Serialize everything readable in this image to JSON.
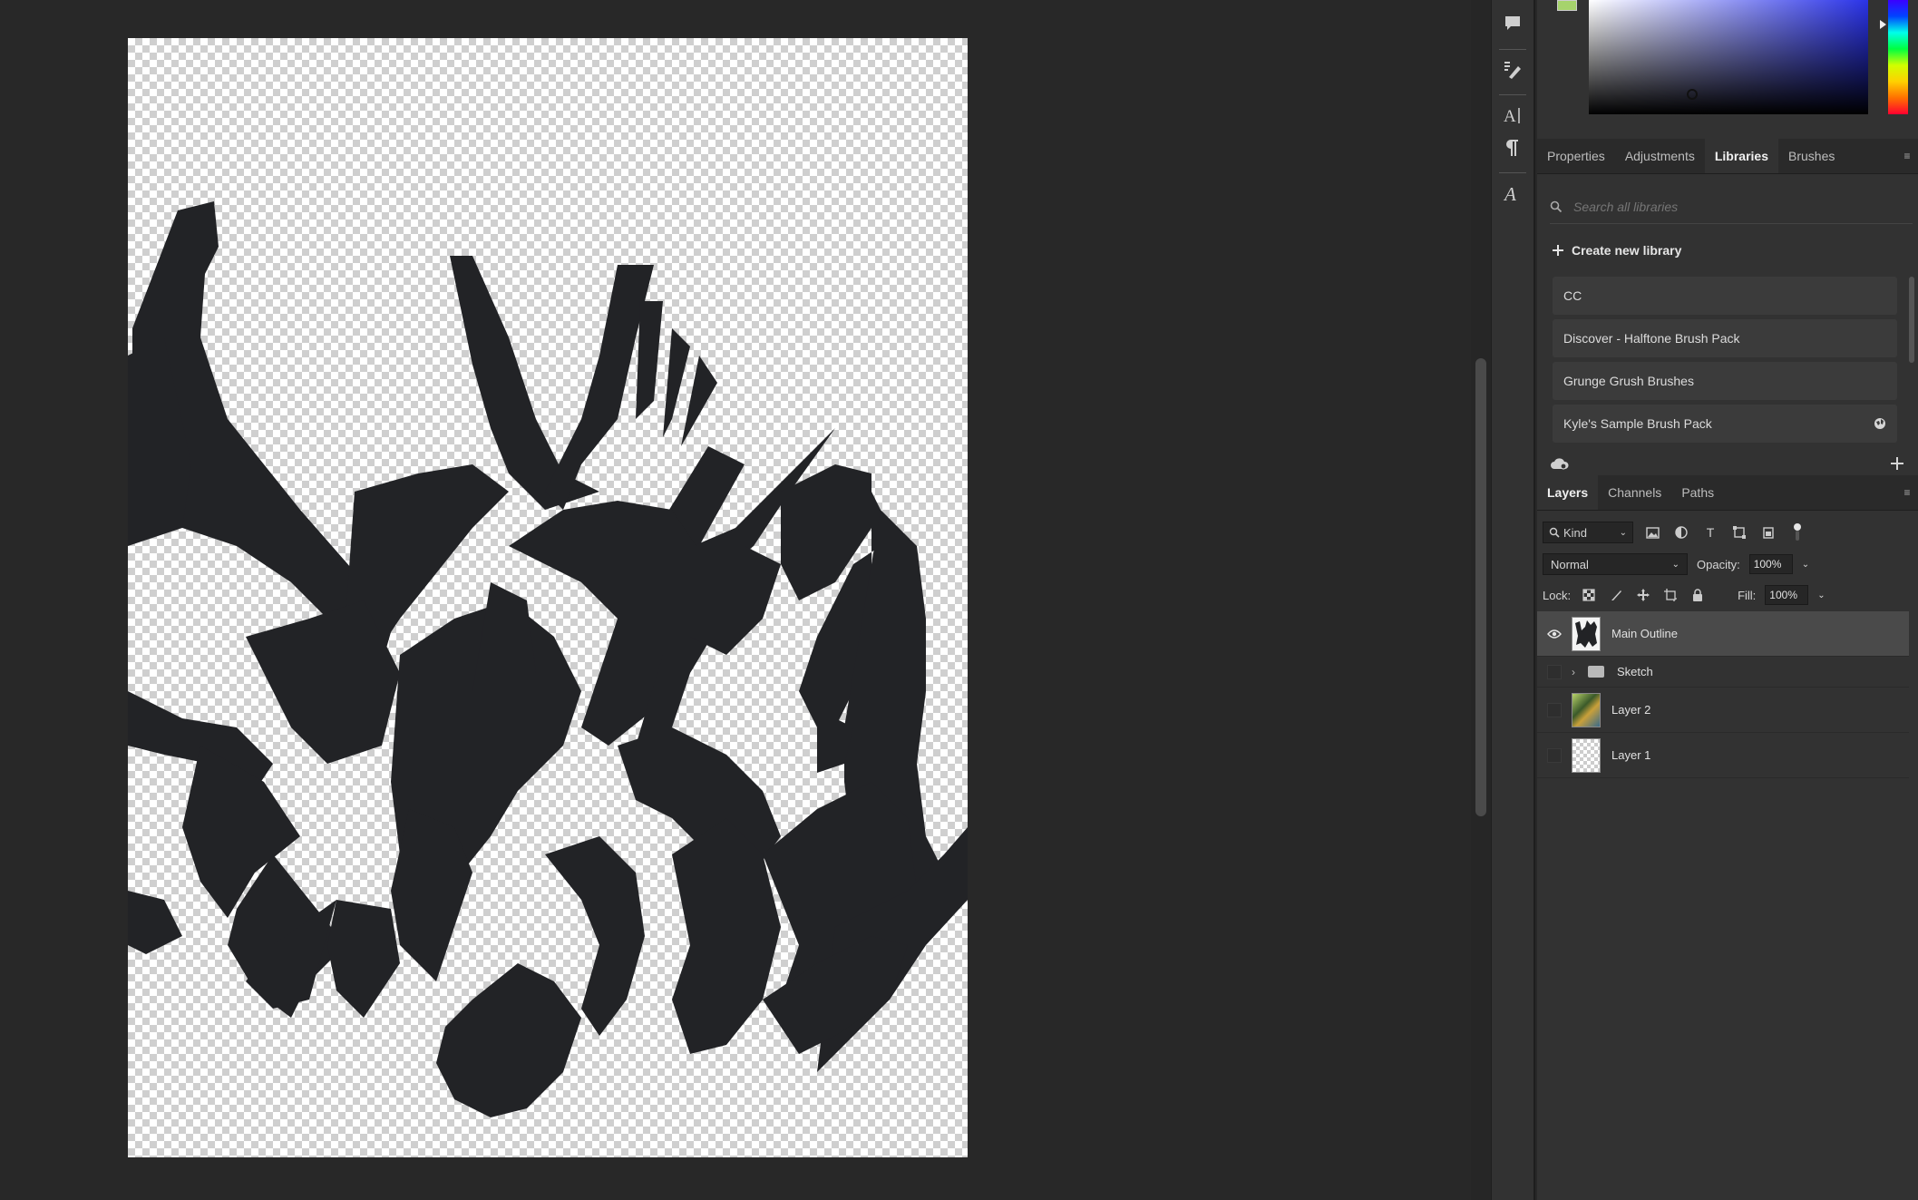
{
  "panel_tabs": {
    "properties": "Properties",
    "adjustments": "Adjustments",
    "libraries": "Libraries",
    "brushes": "Brushes"
  },
  "libraries": {
    "search_placeholder": "Search all libraries",
    "create_label": "Create new library",
    "items": [
      {
        "label": "CC"
      },
      {
        "label": "Discover - Halftone Brush Pack"
      },
      {
        "label": "Grunge Grush Brushes"
      },
      {
        "label": "Kyle's Sample Brush Pack"
      }
    ]
  },
  "layer_tabs": {
    "layers": "Layers",
    "channels": "Channels",
    "paths": "Paths"
  },
  "layer_controls": {
    "kind": "Kind",
    "blend_mode": "Normal",
    "opacity_label": "Opacity:",
    "opacity_value": "100%",
    "lock_label": "Lock:",
    "fill_label": "Fill:",
    "fill_value": "100%"
  },
  "layers": [
    {
      "name": "Main Outline",
      "visible": true,
      "selected": true
    },
    {
      "name": "Sketch",
      "type": "group",
      "visible": false
    },
    {
      "name": "Layer 2",
      "visible": false
    },
    {
      "name": "Layer 1",
      "visible": false
    }
  ],
  "colors": {
    "foreground_swatch": "#a6d36c",
    "artwork_fill": "#222326"
  }
}
